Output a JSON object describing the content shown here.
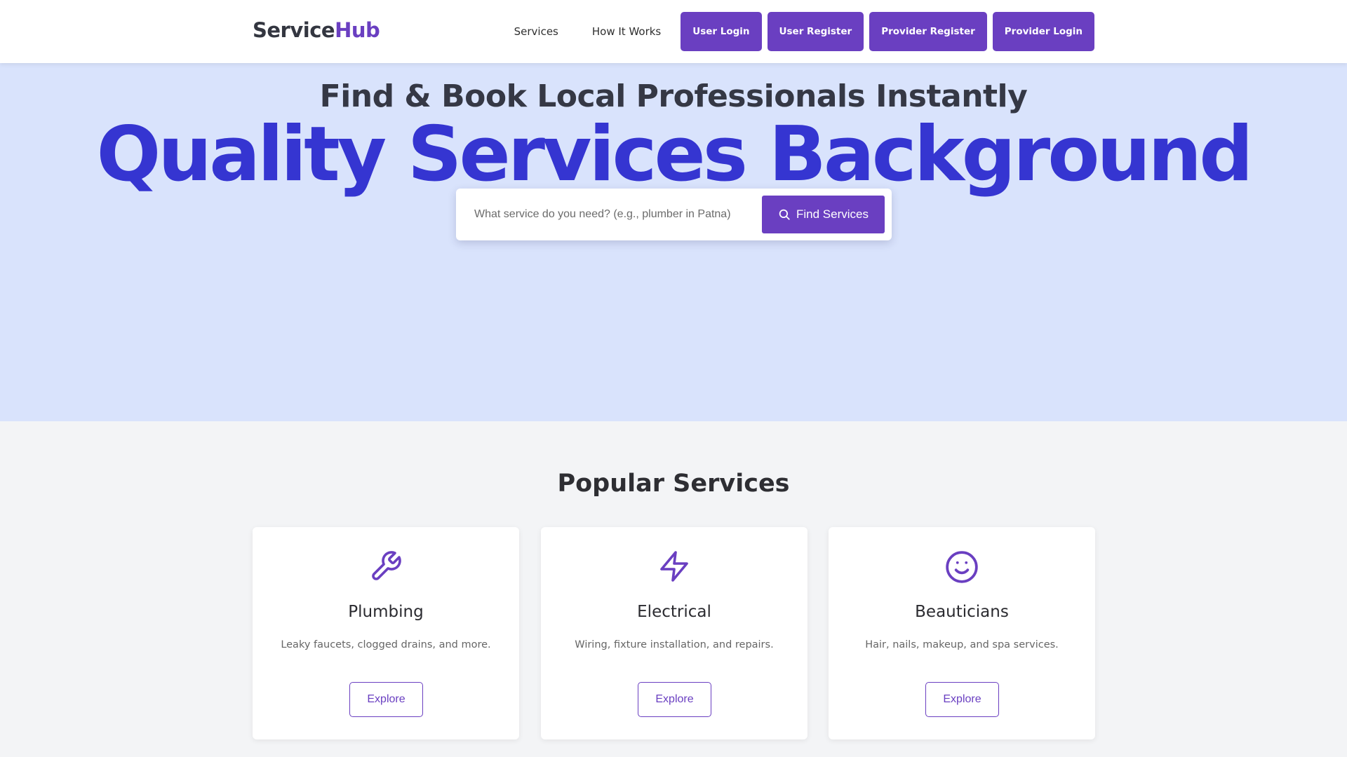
{
  "header": {
    "logo_part1": "Service",
    "logo_part2": "Hub",
    "nav_links": [
      "Services",
      "How It Works"
    ],
    "nav_buttons": [
      "User Login",
      "User Register",
      "Provider Register",
      "Provider Login"
    ]
  },
  "hero": {
    "subtitle": "Find & Book Local Professionals Instantly",
    "title": "Quality Services Background",
    "search_placeholder": "What service do you need? (e.g., plumber in Patna)",
    "search_button": "Find Services",
    "search_icon": "search-icon"
  },
  "services": {
    "title": "Popular Services",
    "cards": [
      {
        "icon": "wrench-icon",
        "title": "Plumbing",
        "description": "Leaky faucets, clogged drains, and more.",
        "button": "Explore"
      },
      {
        "icon": "lightning-icon",
        "title": "Electrical",
        "description": "Wiring, fixture installation, and repairs.",
        "button": "Explore"
      },
      {
        "icon": "smiley-icon",
        "title": "Beauticians",
        "description": "Hair, nails, makeup, and spa services.",
        "button": "Explore"
      }
    ]
  },
  "colors": {
    "brand": "#6a3fc1",
    "hero_bg": "#d9e3fc",
    "hero_title": "#3535d1",
    "page_bg": "#f3f4f6"
  }
}
